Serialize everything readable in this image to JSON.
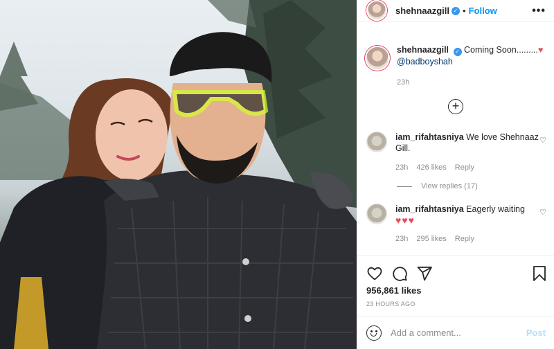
{
  "header": {
    "username": "shehnaazgill",
    "separator": "•",
    "follow_label": "Follow",
    "more_label": "•••"
  },
  "caption": {
    "username": "shehnaazgill",
    "text": "Coming Soon.........",
    "heart": "♥",
    "mention": "@badboyshah",
    "time": "23h"
  },
  "load_more_icon": "plus-circle-icon",
  "comments": [
    {
      "username": "iam_rifahtasniya",
      "text": "We love Shehnaaz Gill.",
      "time": "23h",
      "likes": "426 likes",
      "reply_label": "Reply"
    },
    {
      "username": "iam_rifahtasniya",
      "text": "Eagerly waiting",
      "hearts": "♥♥♥",
      "time": "23h",
      "likes": "295 likes",
      "reply_label": "Reply"
    }
  ],
  "view_replies": "View replies (17)",
  "actions": {
    "like_icon": "heart-icon",
    "comment_icon": "comment-icon",
    "share_icon": "paper-plane-icon",
    "save_icon": "bookmark-icon"
  },
  "likes_count": "956,861 likes",
  "posted_ago": "23 HOURS AGO",
  "add_comment": {
    "placeholder": "Add a comment...",
    "post_label": "Post"
  },
  "colors": {
    "accent_blue": "#0095f6",
    "verified_blue": "#3897f0",
    "heart_red": "#ed4956",
    "muted_gray": "#8e8e8e"
  }
}
